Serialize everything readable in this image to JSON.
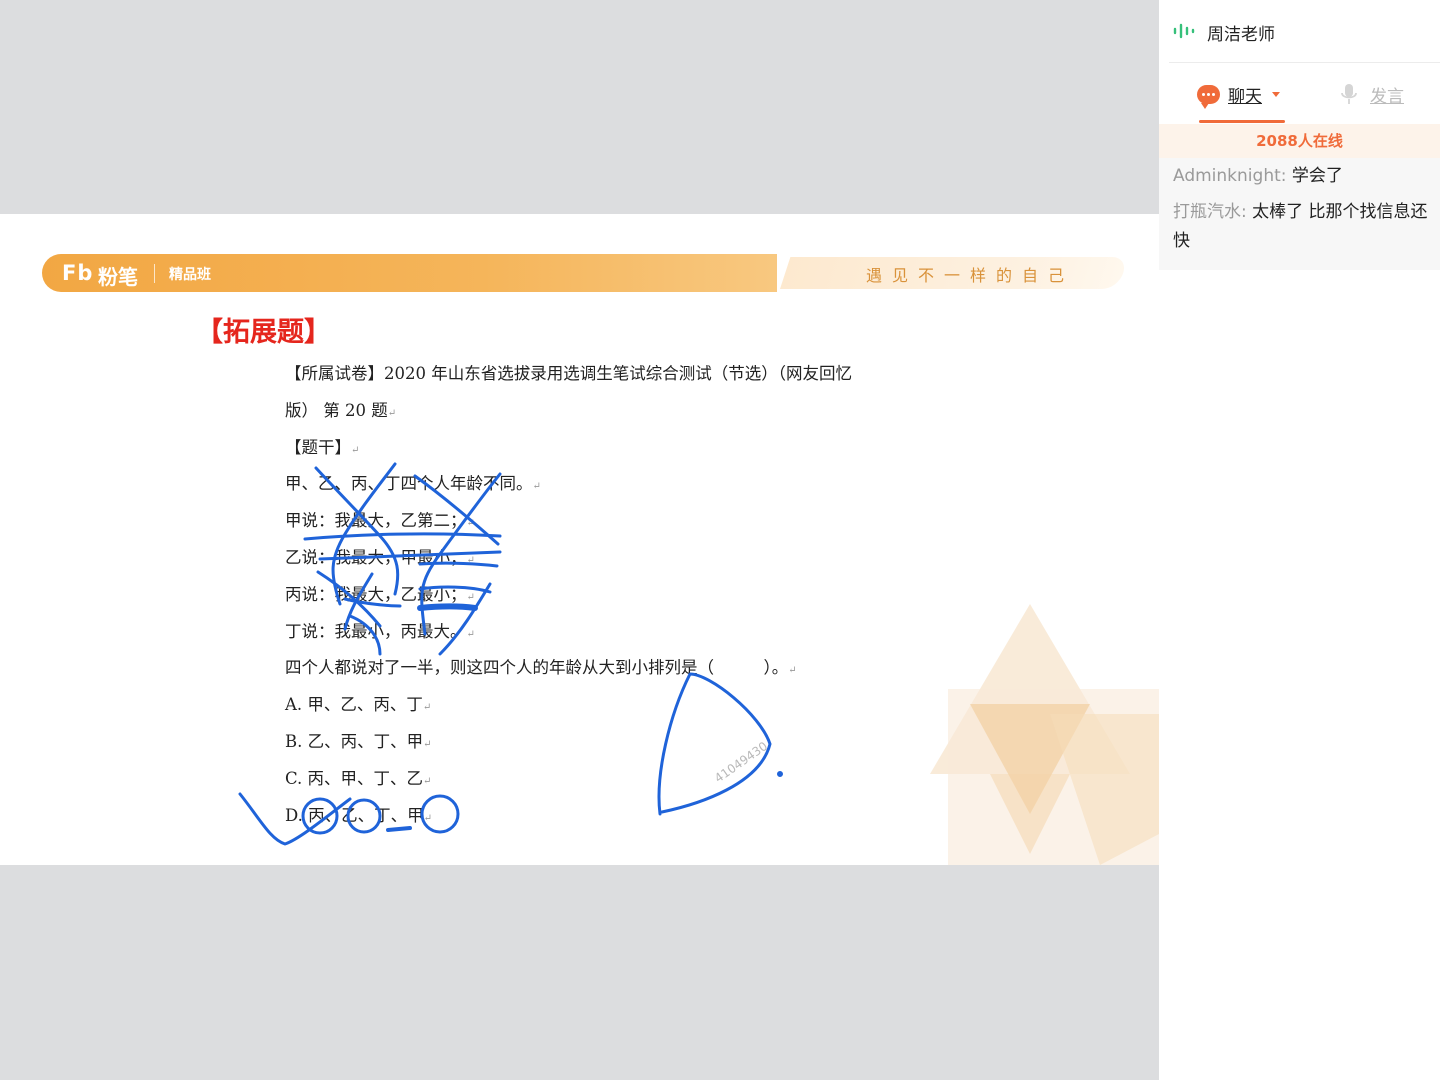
{
  "slide": {
    "brand_logo": "Fb",
    "brand_name": "粉笔",
    "class_tag": "精品班",
    "slogan": "遇见不一样的自己",
    "section_title": "【拓展题】",
    "source_line1": "【所属试卷】2020 年山东省选拔录用选调生笔试综合测试（节选）（网友回忆",
    "source_line2": "版） 第 20 题",
    "stem_label": "【题干】",
    "stem": "甲、乙、丙、丁四个人年龄不同。",
    "statement_jia": "甲说：我最大，乙第二；",
    "statement_yi": "乙说：我最大，甲最小；",
    "statement_bing": "丙说：我最大，乙最小；",
    "statement_ding": "丁说：我最小，丙最大。",
    "question": "四个人都说对了一半，则这四个人的年龄从大到小排列是（　　　）。",
    "option_a": "A. 甲、乙、丙、丁",
    "option_b": "B. 乙、丙、丁、甲",
    "option_c": "C. 丙、甲、丁、乙",
    "option_d": "D. 丙、乙、丁、甲",
    "paragraph_mark": "↵",
    "watermark": "41049430"
  },
  "panel": {
    "teacher_name": "周洁老师",
    "tab_chat": "聊天",
    "tab_speak": "发言",
    "online_count": "2088人在线",
    "messages": [
      {
        "user": "Adminknight:",
        "text": " 学会了"
      },
      {
        "user": "打瓶汽水:",
        "text": " 太棒了 比那个找信息还快"
      }
    ]
  },
  "colors": {
    "accent": "#f06b3a",
    "banner": "#f2a743",
    "title_red": "#e5261d",
    "ink": "#1f63d9"
  },
  "icons": [
    "sound-wave-icon",
    "chat-bubble-icon",
    "chevron-down-icon",
    "microphone-icon"
  ]
}
